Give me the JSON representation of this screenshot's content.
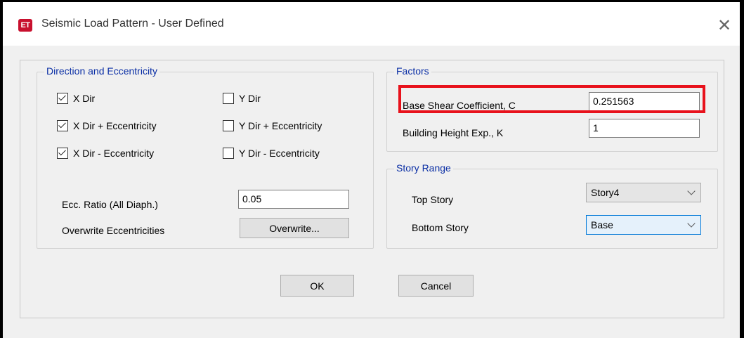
{
  "window": {
    "title": "Seismic Load Pattern - User Defined",
    "app_icon_text": "ET",
    "close_glyph": "✕"
  },
  "direction": {
    "group_label": "Direction and Eccentricity",
    "checkboxes": [
      {
        "label": "X Dir",
        "checked": true
      },
      {
        "label": "X Dir + Eccentricity",
        "checked": true
      },
      {
        "label": "X Dir - Eccentricity",
        "checked": true
      },
      {
        "label": "Y Dir",
        "checked": false
      },
      {
        "label": "Y Dir + Eccentricity",
        "checked": false
      },
      {
        "label": "Y Dir - Eccentricity",
        "checked": false
      }
    ],
    "ecc_ratio_label": "Ecc. Ratio (All Diaph.)",
    "ecc_ratio_value": "0.05",
    "overwrite_label": "Overwrite Eccentricities",
    "overwrite_button": "Overwrite..."
  },
  "factors": {
    "group_label": "Factors",
    "base_shear_label": "Base Shear Coefficient, C",
    "base_shear_value": "0.251563",
    "height_exp_label": "Building Height Exp., K",
    "height_exp_value": "1"
  },
  "story_range": {
    "group_label": "Story Range",
    "top_label": "Top Story",
    "top_value": "Story4",
    "bottom_label": "Bottom Story",
    "bottom_value": "Base"
  },
  "buttons": {
    "ok": "OK",
    "cancel": "Cancel"
  },
  "colors": {
    "highlight": "#e8121c",
    "group_label": "#0b2fa5",
    "app_icon": "#c8102e"
  }
}
